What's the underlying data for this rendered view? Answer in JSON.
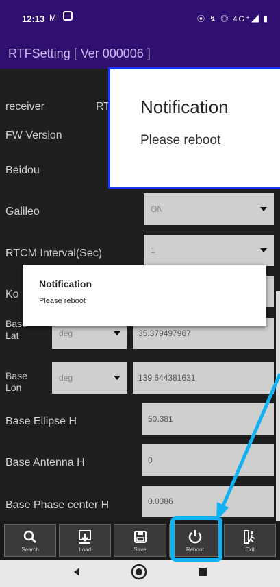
{
  "status_bar": {
    "time": "12:13",
    "notif_glyph": "M",
    "right_icons": "⦿ ↯ ◎ 4G⁺◢ ▮"
  },
  "app": {
    "title": "RTFSetting  [ Ver 000006 ]"
  },
  "rows": {
    "receiver": "receiver",
    "receiver_value": "RT",
    "fw_version": "FW Version",
    "beidou": "Beidou",
    "galileo": "Galileo",
    "galileo_value": "ON",
    "rtcm_interval": "RTCM Interval(Sec)",
    "rtcm_value": "1",
    "ko": "Ko",
    "base_lat": "Base\nLat",
    "base_lat_unit": "deg",
    "base_lat_value": "35.379497967",
    "base_lon": "Base\nLon",
    "base_lon_unit": "deg",
    "base_lon_value": "139.644381631",
    "base_ellipse_h": "Base Ellipse H",
    "base_ellipse_value": "50.381",
    "base_antenna_h": "Base Antenna H",
    "base_antenna_value": "0",
    "base_phase_h": "Base Phase center H",
    "base_phase_value": "0.0386"
  },
  "dialog_big": {
    "title": "Notification",
    "message": "Please reboot"
  },
  "dialog_small": {
    "title": "Notification",
    "message": "Please reboot"
  },
  "toolbar": {
    "search": "Search",
    "load": "Load",
    "save": "Save",
    "reboot": "Reboot",
    "exit": "Exit"
  },
  "colors": {
    "status_bg": "#2f0f70",
    "highlight": "#10b2f2",
    "dialog_border": "#1436ff"
  }
}
